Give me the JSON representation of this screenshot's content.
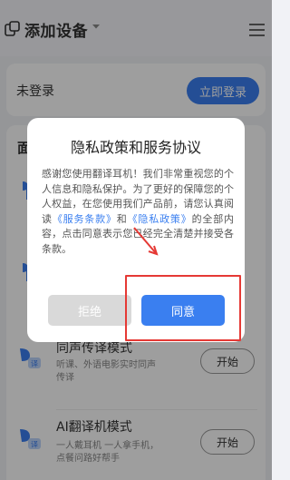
{
  "header": {
    "title": "添加设备",
    "device_icon": "devices-icon",
    "caret_icon": "caret-down-icon",
    "menu_icon": "hamburger-menu-icon"
  },
  "login": {
    "status": "未登录",
    "button": "立即登录"
  },
  "modes": {
    "heading": "面",
    "items": [
      {
        "icon": "translate-mode-icon",
        "title": "同声传译模式",
        "desc": "听课、外语电影实时同声传译",
        "button": "开始"
      },
      {
        "icon": "ai-translate-icon",
        "title": "AI翻译机模式",
        "desc": "一人戴耳机 一人拿手机，点餐问路好帮手",
        "button": "开始"
      }
    ]
  },
  "modal": {
    "title": "隐私政策和服务协议",
    "body_part1": "感谢您使用翻译耳机！我们非常重视您的个人信息和隐私保护。为了更好的保障您的个人权益，在您使用我们产品前，请您认真阅读",
    "link_service": "《服务条款》",
    "body_part2": "和",
    "link_privacy": "《隐私政策》",
    "body_part3": "的全部内容，点击同意表示您已经完全清楚并接受各条款。",
    "decline": "拒绝",
    "agree": "同意"
  },
  "colors": {
    "accent": "#3a7ff0",
    "annotation": "#e53935"
  }
}
